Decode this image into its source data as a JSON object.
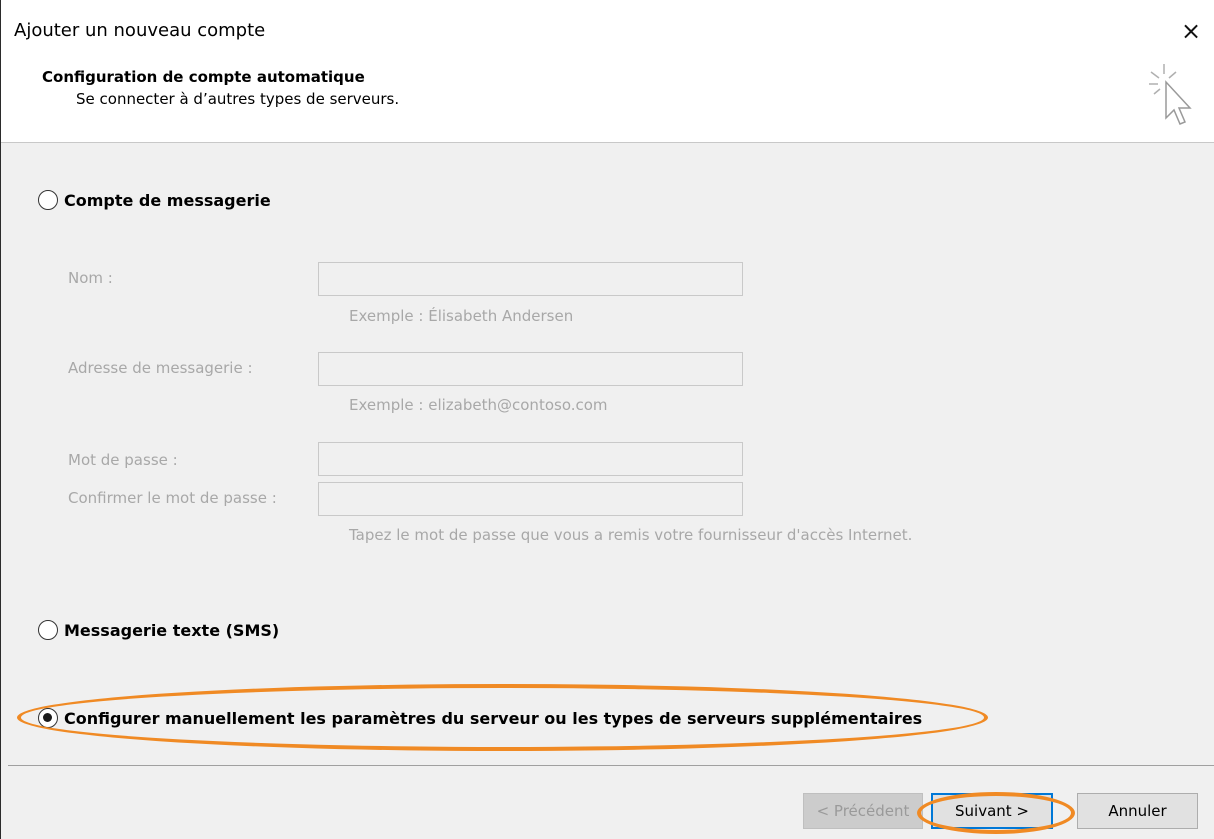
{
  "window": {
    "title": "Ajouter un nouveau compte",
    "close_glyph": "×"
  },
  "header": {
    "title": "Configuration de compte automatique",
    "subtitle": "Se connecter à d’autres types de serveurs.",
    "icon": "wizard-cursor-icon"
  },
  "options": {
    "email_account": {
      "label": "Compte de messagerie",
      "selected": false
    },
    "sms": {
      "label": "Messagerie texte (SMS)",
      "selected": false
    },
    "manual": {
      "label": "Configurer manuellement les paramètres du serveur ou les types de serveurs supplémentaires",
      "selected": true
    }
  },
  "form": {
    "name": {
      "label": "Nom :",
      "value": "",
      "hint": "Exemple : Élisabeth Andersen"
    },
    "email": {
      "label": "Adresse de messagerie :",
      "value": "",
      "hint": "Exemple : elizabeth@contoso.com"
    },
    "password": {
      "label": "Mot de passe :",
      "value": ""
    },
    "confirm_password": {
      "label": "Confirmer le mot de passe :",
      "value": "",
      "hint": "Tapez le mot de passe que vous a remis votre fournisseur d'accès Internet."
    }
  },
  "buttons": {
    "back": "< Précédent",
    "next": "Suivant >",
    "cancel": "Annuler"
  },
  "colors": {
    "annotation": "#f08a24",
    "default_button_border": "#0078d7",
    "disabled_text": "#a8a8a8"
  }
}
